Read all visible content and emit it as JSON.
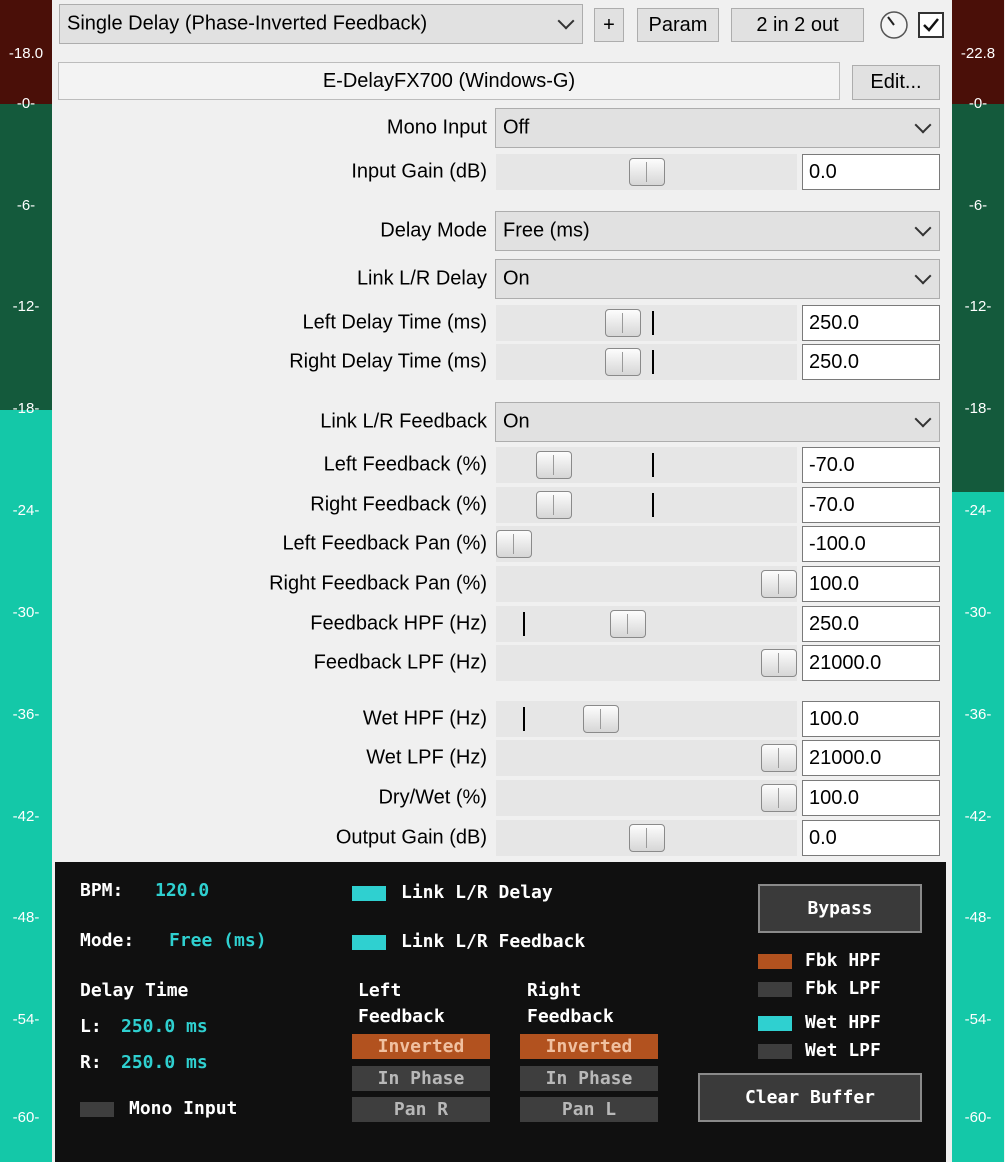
{
  "header": {
    "preset": "Single Delay (Phase-Inverted Feedback)",
    "add_label": "+",
    "param_label": "Param",
    "io_label": "2 in 2 out",
    "enabled": true
  },
  "plugin": {
    "name": "E-DelayFX700 (Windows-G)",
    "edit_label": "Edit..."
  },
  "meters": {
    "left_peak": "-18.0",
    "right_peak": "-22.8",
    "scale": [
      "-0-",
      "-6-",
      "-12-",
      "-18-",
      "-24-",
      "-30-",
      "-36-",
      "-42-",
      "-48-",
      "-54-",
      "-60-"
    ],
    "left_level_db": -18.0,
    "right_level_db": -22.8,
    "colors": {
      "peak": "#4a0f08",
      "dim": "#145a3c",
      "lit": "#14c8a8"
    }
  },
  "params": [
    {
      "kind": "select",
      "label": "Mono Input",
      "value": "Off"
    },
    {
      "kind": "slider",
      "label": "Input Gain (dB)",
      "value": "0.0",
      "pos": 0.5
    },
    {
      "kind": "select",
      "label": "Delay Mode",
      "value": "Free (ms)"
    },
    {
      "kind": "select",
      "label": "Link L/R Delay",
      "value": "On"
    },
    {
      "kind": "slider",
      "label": "Left Delay Time (ms)",
      "value": "250.0",
      "pos": 0.41,
      "mark": 0.5
    },
    {
      "kind": "slider",
      "label": "Right Delay Time (ms)",
      "value": "250.0",
      "pos": 0.41,
      "mark": 0.5
    },
    {
      "kind": "select",
      "label": "Link L/R Feedback",
      "value": "On"
    },
    {
      "kind": "slider",
      "label": "Left Feedback (%)",
      "value": "-70.0",
      "pos": 0.15,
      "mark": 0.5
    },
    {
      "kind": "slider",
      "label": "Right Feedback (%)",
      "value": "-70.0",
      "pos": 0.15,
      "mark": 0.5
    },
    {
      "kind": "slider",
      "label": "Left Feedback Pan (%)",
      "value": "-100.0",
      "pos": 0.0
    },
    {
      "kind": "slider",
      "label": "Right Feedback Pan (%)",
      "value": "100.0",
      "pos": 1.0
    },
    {
      "kind": "slider",
      "label": "Feedback HPF (Hz)",
      "value": "250.0",
      "pos": 0.43,
      "mark": 0.07
    },
    {
      "kind": "slider",
      "label": "Feedback LPF (Hz)",
      "value": "21000.0",
      "pos": 1.0
    },
    {
      "kind": "slider",
      "label": "Wet HPF (Hz)",
      "value": "100.0",
      "pos": 0.33,
      "mark": 0.07
    },
    {
      "kind": "slider",
      "label": "Wet LPF (Hz)",
      "value": "21000.0",
      "pos": 1.0
    },
    {
      "kind": "slider",
      "label": "Dry/Wet (%)",
      "value": "100.0",
      "pos": 1.0
    },
    {
      "kind": "slider",
      "label": "Output Gain (dB)",
      "value": "0.0",
      "pos": 0.5
    }
  ],
  "panel": {
    "bpm_label": "BPM:",
    "bpm_value": "120.0",
    "mode_label": "Mode:",
    "mode_value": "Free (ms)",
    "delay_time_label": "Delay Time",
    "l_label": "L:",
    "l_value": "250.0 ms",
    "r_label": "R:",
    "r_value": "250.0 ms",
    "mono_input_label": "Mono Input",
    "link_delay_label": "Link L/R Delay",
    "link_feedback_label": "Link L/R Feedback",
    "left_fb_title_1": "Left",
    "left_fb_title_2": "Feedback",
    "right_fb_title_1": "Right",
    "right_fb_title_2": "Feedback",
    "inverted": "Inverted",
    "in_phase": "In Phase",
    "pan_r": "Pan R",
    "pan_l": "Pan L",
    "bypass_label": "Bypass",
    "fbk_hpf": "Fbk HPF",
    "fbk_lpf": "Fbk LPF",
    "wet_hpf": "Wet HPF",
    "wet_lpf": "Wet LPF",
    "clear_buffer_label": "Clear Buffer",
    "colors": {
      "cyan": "#2fd0d0",
      "orange": "#b2521f",
      "off": "#3e3e3e"
    }
  }
}
